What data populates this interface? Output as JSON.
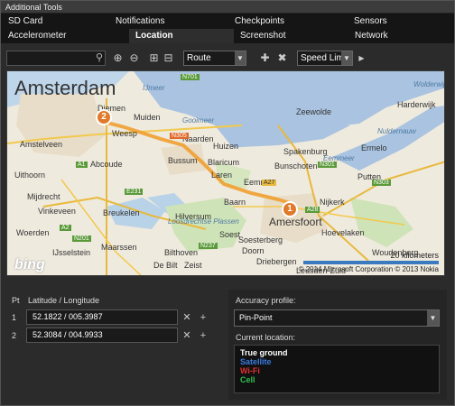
{
  "window": {
    "title": "Additional Tools"
  },
  "tabs": {
    "row1": [
      {
        "label": "SD Card"
      },
      {
        "label": "Notifications"
      },
      {
        "label": "Checkpoints"
      },
      {
        "label": "Sensors"
      }
    ],
    "row2": [
      {
        "label": "Accelerometer"
      },
      {
        "label": "Location",
        "active": true
      },
      {
        "label": "Screenshot"
      },
      {
        "label": "Network"
      }
    ]
  },
  "toolbar": {
    "search_value": "",
    "route_select": "Route",
    "speed_select": "Speed Limit"
  },
  "map": {
    "city_labels": {
      "amsterdam": "Amsterdam",
      "amersfoort": "Amersfoort",
      "utrecht": "",
      "hilversum": "Hilversum",
      "bussum": "Bussum",
      "huizen": "Huizen",
      "blaricum": "Blaricum",
      "laren": "Laren",
      "baarn": "Baarn",
      "soest": "Soest",
      "weesp": "Weesp",
      "diemen": "Diemen",
      "muiden": "Muiden",
      "naarden": "Naarden",
      "abcoude": "Abcoude",
      "loosdrecht": "Loosdrecht",
      "nijkerk": "Nijkerk",
      "ermelo": "Ermelo",
      "putten": "Putten",
      "harderwijk": "Harderwijk",
      "leusden": "Leusden-Zuid",
      "hoevelaken": "Hoevelaken",
      "zeewolde": "Zeewolde",
      "almere": "",
      "woerden": "Woerden",
      "mijdrecht": "Mijdrecht",
      "vinkeveen": "Vinkeveen",
      "breukelen": "Breukelen",
      "maarssen": "Maarssen",
      "zeist": "Zeist",
      "bilthoven": "Bilthoven",
      "de_bilt": "De Bilt",
      "bunschoten": "Bunschoten",
      "eemnes": "Eemnes",
      "uithoorn": "Uithoorn",
      "amstelveen": "Amstelveen",
      "nieuwegein": "",
      "ijsselstein": "IJsselstein",
      "houten": "",
      "lelystad": "",
      "woudenberg": "Woudenberg",
      "scherpenzeel": "",
      "doorn": "Doorn",
      "driebergen": "Driebergen",
      "soesterberg": "Soesterberg",
      "spakenburg": "Spakenburg"
    },
    "water_labels": {
      "gooimeer": "Gooimeer",
      "loosdrecht_lakes": "Loosdrechtse Plassen",
      "ijmeer": "IJmeer",
      "eemmeer": "Eemmeer",
      "nuldernauw": "Nuldernauw",
      "wolderwijd": "Wolderwijd"
    },
    "road_labels": {
      "n701": "N701",
      "n305": "N305",
      "a1": "A1",
      "a28": "A28",
      "n301": "N301",
      "n303": "N303",
      "a27": "A27",
      "e231": "E231",
      "a2": "A2",
      "n201": "N201",
      "n237": "N237"
    },
    "pins": [
      {
        "label": "1"
      },
      {
        "label": "2"
      }
    ],
    "scale_text": "20 kilometers",
    "copyright": "© 2014 Microsoft Corporation  © 2013 Nokia",
    "logo": "bing"
  },
  "points": {
    "header_pt": "Pt",
    "header_coord": "Latitude / Longitude",
    "rows": [
      {
        "num": "1",
        "coords": "52.1822 / 005.3987"
      },
      {
        "num": "2",
        "coords": "52.3084 / 004.9933"
      }
    ]
  },
  "accuracy": {
    "label": "Accuracy profile:",
    "selected": "Pin-Point",
    "current_label": "Current location:",
    "sources": [
      {
        "text": "True ground",
        "color": "#ffffff"
      },
      {
        "text": "Satellite",
        "color": "#3a7be0"
      },
      {
        "text": "Wi-Fi",
        "color": "#e03030"
      },
      {
        "text": "Cell",
        "color": "#2ec24b"
      }
    ]
  }
}
